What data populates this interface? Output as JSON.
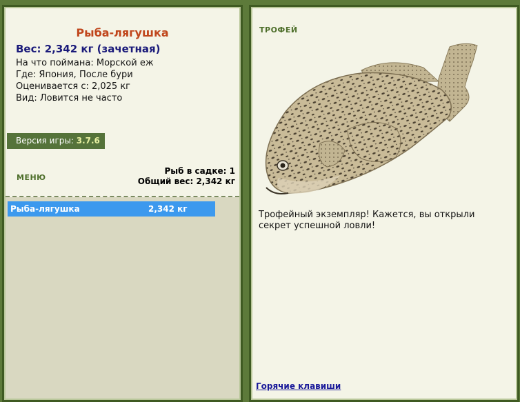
{
  "fish": {
    "name": "Рыба-лягушка",
    "weight_line": "Вес: 2,342 кг (зачетная)",
    "bait": "На что поймана: Морской еж",
    "location": "Где: Япония, После бури",
    "rated_from": "Оценивается с: 2,025 кг",
    "rarity": "Вид: Ловится не часто"
  },
  "version": {
    "label": "Версия игры:",
    "number": "3.7.6"
  },
  "menu": {
    "label": "МЕНЮ"
  },
  "keepnet": {
    "count_line": "Рыб в садке: 1",
    "total_weight_line": "Общий вес: 2,342 кг",
    "items": [
      {
        "name": "Рыба-лягушка",
        "weight": "2,342 кг"
      }
    ]
  },
  "trophy": {
    "label": "ТРОФЕЙ",
    "message": "Трофейный экземпляр! Кажется, вы открыли секрет успешной ловли!"
  },
  "hotkeys": {
    "label": "Горячие клавиши"
  },
  "colors": {
    "background": "#5d7a3a",
    "panel": "#f4f4e7",
    "fish_name": "#c0461c",
    "weight": "#1a1a7a",
    "selected_row": "#3c99ee"
  }
}
